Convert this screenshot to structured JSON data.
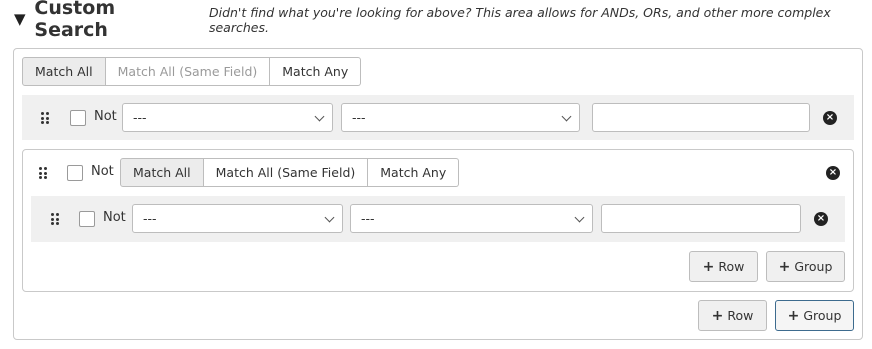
{
  "section": {
    "caret": "▼",
    "title": "Custom Search",
    "description": "Didn't find what you're looking for above? This area allows for ANDs, ORs, and other more complex searches."
  },
  "match_modes": [
    "Match All",
    "Match All (Same Field)",
    "Match Any"
  ],
  "top_group": {
    "active_mode": "Match All",
    "disabled_mode": "Match All (Same Field)",
    "row": {
      "not_label": "Not",
      "field_value": "---",
      "operator_value": "---",
      "value": ""
    }
  },
  "nested_group": {
    "not_label": "Not",
    "active_mode": "Match All",
    "row": {
      "not_label": "Not",
      "field_value": "---",
      "operator_value": "---",
      "value": ""
    },
    "add_row_label": "Row",
    "add_group_label": "Group"
  },
  "add_row_label": "Row",
  "add_group_label": "Group",
  "icons": {
    "plus": "+",
    "remove": "×"
  }
}
